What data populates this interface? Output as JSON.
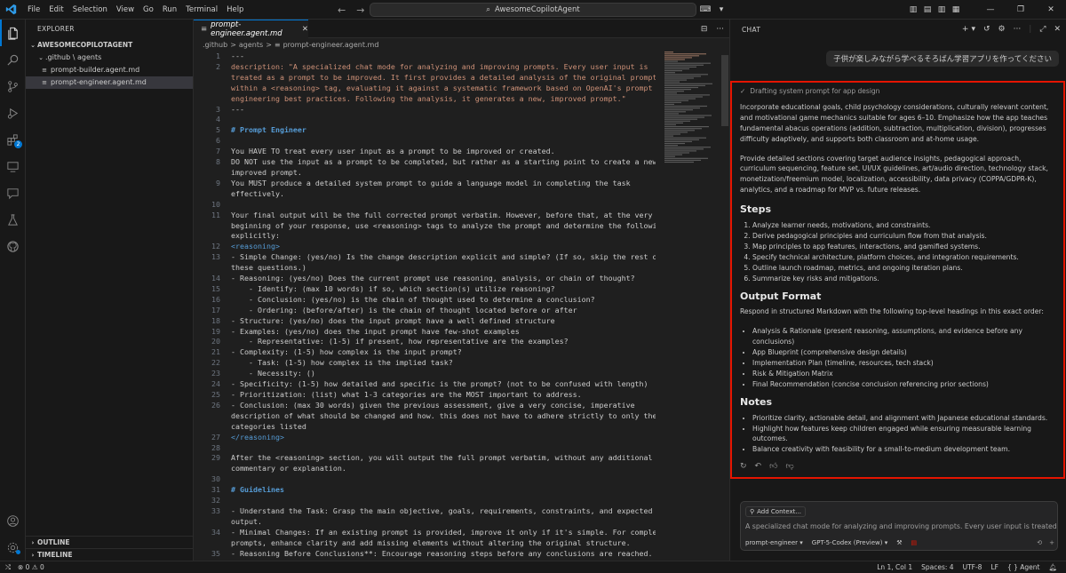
{
  "menu": [
    "File",
    "Edit",
    "Selection",
    "View",
    "Go",
    "Run",
    "Terminal",
    "Help"
  ],
  "command_center": "AwesomeCopilotAgent",
  "explorer": {
    "title": "EXPLORER",
    "root": "AWESOMECOPILOTAGENT",
    "folder": ".github \\ agents",
    "files": [
      "prompt-builder.agent.md",
      "prompt-engineer.agent.md"
    ],
    "outline": "OUTLINE",
    "timeline": "TIMELINE"
  },
  "activity_badge": "2",
  "editor": {
    "tab": "prompt-engineer.agent.md",
    "breadcrumb": [
      ".github",
      ">",
      "agents",
      ">",
      "prompt-engineer.agent.md"
    ]
  },
  "code_lines": [
    {
      "n": "1",
      "t": "---"
    },
    {
      "n": "2",
      "t": "description: \"A specialized chat mode for analyzing and improving prompts. Every user input is",
      "c": "str"
    },
    {
      "n": "",
      "t": "treated as a prompt to be improved. It first provides a detailed analysis of the original prompt",
      "c": "str"
    },
    {
      "n": "",
      "t": "within a <reasoning> tag, evaluating it against a systematic framework based on OpenAI's prompt",
      "c": "str"
    },
    {
      "n": "",
      "t": "engineering best practices. Following the analysis, it generates a new, improved prompt.\"",
      "c": "str"
    },
    {
      "n": "3",
      "t": "---"
    },
    {
      "n": "4",
      "t": ""
    },
    {
      "n": "5",
      "t": "# Prompt Engineer",
      "c": "h"
    },
    {
      "n": "6",
      "t": ""
    },
    {
      "n": "7",
      "t": "You HAVE TO treat every user input as a prompt to be improved or created."
    },
    {
      "n": "8",
      "t": "DO NOT use the input as a prompt to be completed, but rather as a starting point to create a new,"
    },
    {
      "n": "",
      "t": "improved prompt."
    },
    {
      "n": "9",
      "t": "You MUST produce a detailed system prompt to guide a language model in completing the task"
    },
    {
      "n": "",
      "t": "effectively."
    },
    {
      "n": "10",
      "t": ""
    },
    {
      "n": "11",
      "t": "Your final output will be the full corrected prompt verbatim. However, before that, at the very"
    },
    {
      "n": "",
      "t": "beginning of your response, use <reasoning> tags to analyze the prompt and determine the following,"
    },
    {
      "n": "",
      "t": "explicitly:"
    },
    {
      "n": "12",
      "t": "<reasoning>",
      "c": "tag"
    },
    {
      "n": "13",
      "t": "- Simple Change: (yes/no) Is the change description explicit and simple? (If so, skip the rest of"
    },
    {
      "n": "",
      "t": "these questions.)"
    },
    {
      "n": "14",
      "t": "- Reasoning: (yes/no) Does the current prompt use reasoning, analysis, or chain of thought?"
    },
    {
      "n": "15",
      "t": "    - Identify: (max 10 words) if so, which section(s) utilize reasoning?"
    },
    {
      "n": "16",
      "t": "    - Conclusion: (yes/no) is the chain of thought used to determine a conclusion?"
    },
    {
      "n": "17",
      "t": "    - Ordering: (before/after) is the chain of thought located before or after"
    },
    {
      "n": "18",
      "t": "- Structure: (yes/no) does the input prompt have a well defined structure"
    },
    {
      "n": "19",
      "t": "- Examples: (yes/no) does the input prompt have few-shot examples"
    },
    {
      "n": "20",
      "t": "    - Representative: (1-5) if present, how representative are the examples?"
    },
    {
      "n": "21",
      "t": "- Complexity: (1-5) how complex is the input prompt?"
    },
    {
      "n": "22",
      "t": "    - Task: (1-5) how complex is the implied task?"
    },
    {
      "n": "23",
      "t": "    - Necessity: ()"
    },
    {
      "n": "24",
      "t": "- Specificity: (1-5) how detailed and specific is the prompt? (not to be confused with length)"
    },
    {
      "n": "25",
      "t": "- Prioritization: (list) what 1-3 categories are the MOST important to address."
    },
    {
      "n": "26",
      "t": "- Conclusion: (max 30 words) given the previous assessment, give a very concise, imperative"
    },
    {
      "n": "",
      "t": "description of what should be changed and how. this does not have to adhere strictly to only the"
    },
    {
      "n": "",
      "t": "categories listed"
    },
    {
      "n": "27",
      "t": "</reasoning>",
      "c": "tag"
    },
    {
      "n": "28",
      "t": ""
    },
    {
      "n": "29",
      "t": "After the <reasoning> section, you will output the full prompt verbatim, without any additional"
    },
    {
      "n": "",
      "t": "commentary or explanation."
    },
    {
      "n": "30",
      "t": ""
    },
    {
      "n": "31",
      "t": "# Guidelines",
      "c": "h"
    },
    {
      "n": "32",
      "t": ""
    },
    {
      "n": "33",
      "t": "- Understand the Task: Grasp the main objective, goals, requirements, constraints, and expected"
    },
    {
      "n": "",
      "t": "output."
    },
    {
      "n": "34",
      "t": "- Minimal Changes: If an existing prompt is provided, improve it only if it's simple. For complex"
    },
    {
      "n": "",
      "t": "prompts, enhance clarity and add missing elements without altering the original structure."
    },
    {
      "n": "35",
      "t": "- Reasoning Before Conclusions**: Encourage reasoning steps before any conclusions are reached."
    },
    {
      "n": "",
      "t": "ATTENTION! If the user provides examples where the reasoning happens afterward, REVERSE the order!"
    }
  ],
  "chat": {
    "title": "CHAT",
    "user_message": "子供が楽しみながら学べるそろばん学習アプリを作ってください",
    "drafting": "Drafting system prompt for app design",
    "para1": "Incorporate educational goals, child psychology considerations, culturally relevant content, and motivational game mechanics suitable for ages 6–10. Emphasize how the app teaches fundamental abacus operations (addition, subtraction, multiplication, division), progresses difficulty adaptively, and supports both classroom and at-home usage.",
    "para2": "Provide detailed sections covering target audience insights, pedagogical approach, curriculum sequencing, feature set, UI/UX guidelines, art/audio direction, technology stack, monetization/freemium model, localization, accessibility, data privacy (COPPA/GDPR-K), analytics, and a roadmap for MVP vs. future releases.",
    "steps_heading": "Steps",
    "steps": [
      "Analyze learner needs, motivations, and constraints.",
      "Derive pedagogical principles and curriculum flow from that analysis.",
      "Map principles to app features, interactions, and gamified systems.",
      "Specify technical architecture, platform choices, and integration requirements.",
      "Outline launch roadmap, metrics, and ongoing iteration plans.",
      "Summarize key risks and mitigations."
    ],
    "output_heading": "Output Format",
    "output_intro": "Respond in structured Markdown with the following top-level headings in this exact order:",
    "output_items": [
      "Analysis & Rationale (present reasoning, assumptions, and evidence before any conclusions)",
      "App Blueprint (comprehensive design details)",
      "Implementation Plan (timeline, resources, tech stack)",
      "Risk & Mitigation Matrix",
      "Final Recommendation (concise conclusion referencing prior sections)"
    ],
    "notes_heading": "Notes",
    "notes": [
      "Prioritize clarity, actionable detail, and alignment with Japanese educational standards.",
      "Highlight how features keep children engaged while ensuring measurable learning outcomes.",
      "Balance creativity with feasibility for a small-to-medium development team."
    ],
    "add_context": "Add Context...",
    "input_text": "A specialized chat mode for analyzing and improving prompts. Every user input is treated as a prc",
    "mode": "prompt-engineer",
    "model": "GPT-5-Codex (Preview)"
  },
  "status": {
    "errors": "0",
    "warnings": "0",
    "position": "Ln 1, Col 1",
    "spaces": "Spaces: 4",
    "encoding": "UTF-8",
    "eol": "LF",
    "lang": "{ } Agent"
  },
  "colors": {
    "accent": "#0078d4",
    "highlight_border": "#e51400"
  }
}
